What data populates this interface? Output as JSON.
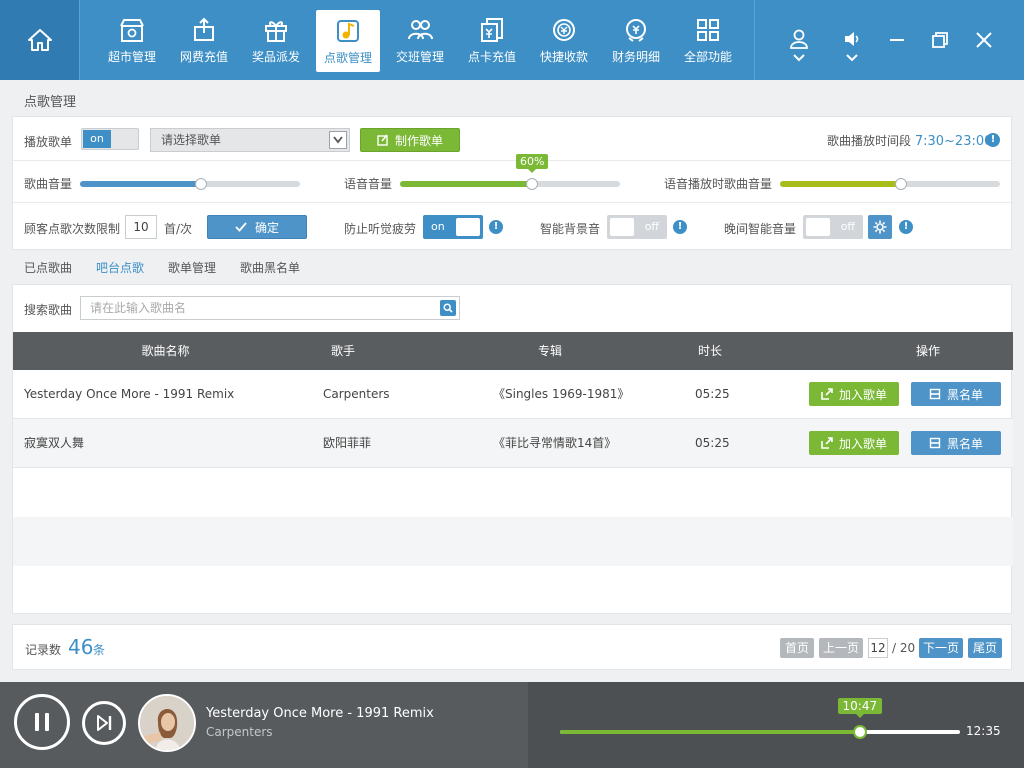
{
  "nav": {
    "items": [
      {
        "label": "超市管理",
        "icon": "store-icon"
      },
      {
        "label": "网费充值",
        "icon": "recharge-icon"
      },
      {
        "label": "奖品派发",
        "icon": "gift-icon"
      },
      {
        "label": "点歌管理",
        "icon": "music-icon",
        "active": true
      },
      {
        "label": "交班管理",
        "icon": "handover-icon"
      },
      {
        "label": "点卡充值",
        "icon": "card-recharge-icon"
      },
      {
        "label": "快捷收款",
        "icon": "quick-pay-icon"
      },
      {
        "label": "财务明细",
        "icon": "finance-icon"
      },
      {
        "label": "全部功能",
        "icon": "all-functions-icon"
      }
    ]
  },
  "page": {
    "title": "点歌管理"
  },
  "settings": {
    "play_list_label": "播放歌单",
    "play_list_toggle": "on",
    "playlist_select_placeholder": "请选择歌单",
    "make_playlist_button": "制作歌单",
    "play_time_label": "歌曲播放时间段",
    "play_time_value": "7:30~23:00",
    "song_volume_label": "歌曲音量",
    "voice_volume_label": "语音音量",
    "voice_volume_tip": "60%",
    "voice_song_volume_label": "语音播放时歌曲音量",
    "song_volume_level": 0.55,
    "voice_volume_level": 0.6,
    "voice_song_volume_level": 0.55,
    "limit_label": "顾客点歌次数限制",
    "limit_value": "10",
    "limit_unit": "首/次",
    "confirm_button": "确定",
    "anti_fatigue_label": "防止听觉疲劳",
    "anti_fatigue_toggle": "on",
    "smart_bg_label": "智能背景音",
    "smart_bg_toggle": "off",
    "night_volume_label": "晚间智能音量",
    "night_volume_toggle": "off"
  },
  "tabs": [
    "已点歌曲",
    "吧台点歌",
    "歌单管理",
    "歌曲黑名单"
  ],
  "active_tab": "吧台点歌",
  "search": {
    "label": "搜索歌曲",
    "placeholder": "请在此输入歌曲名"
  },
  "table": {
    "headers": [
      "歌曲名称",
      "歌手",
      "专辑",
      "时长",
      "操作"
    ],
    "rows": [
      {
        "name": "Yesterday Once More - 1991 Remix",
        "artist": "Carpenters",
        "album": "《Singles 1969-1981》",
        "duration": "05:25"
      },
      {
        "name": "寂寞双人舞",
        "artist": "欧阳菲菲",
        "album": "《菲比寻常情歌14首》",
        "duration": "05:25"
      }
    ],
    "add_label": "加入歌单",
    "blacklist_label": "黑名单"
  },
  "footer": {
    "records_label": "记录数",
    "records_count": "46",
    "records_unit": "条",
    "first_page": "首页",
    "prev_page": "上一页",
    "current_page": "12",
    "total_pages": "/ 20",
    "next_page": "下一页",
    "last_page": "尾页"
  },
  "player": {
    "song_title": "Yesterday Once More - 1991 Remix",
    "song_artist": "Carpenters",
    "current_time": "10:47",
    "total_time": "12:35",
    "progress": 0.75
  },
  "colors": {
    "primary": "#3d8fc6",
    "green": "#7ab836",
    "olive": "#a8bd1a",
    "dark": "#585b5e"
  }
}
